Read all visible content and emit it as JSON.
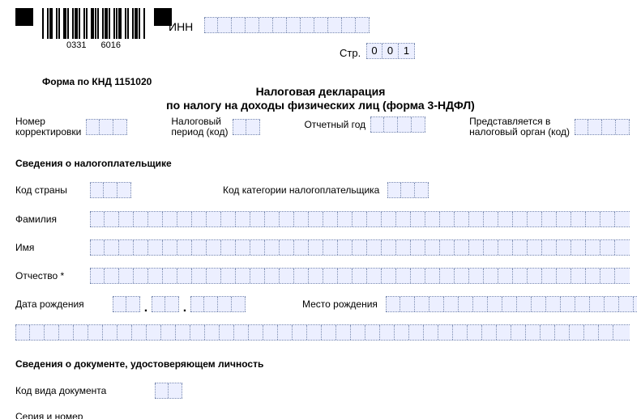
{
  "barcode": {
    "left": "0331",
    "right": "6016"
  },
  "header": {
    "inn_label": "ИНН",
    "page_label": "Стр.",
    "page_value": [
      "0",
      "0",
      "1"
    ],
    "form_knd": "Форма по КНД 1151020",
    "title_line1": "Налоговая декларация",
    "title_line2": "по налогу на доходы физических лиц (форма 3-НДФЛ)"
  },
  "hdr": {
    "correction_label_l1": "Номер",
    "correction_label_l2": "корректировки",
    "tax_period_label_l1": "Налоговый",
    "tax_period_label_l2": "период (код)",
    "report_year_label": "Отчетный год",
    "authority_label_l1": "Представляется в",
    "authority_label_l2": "налоговый орган (код)"
  },
  "section_taxpayer": "Сведения о налогоплательщике",
  "labels": {
    "country_code": "Код страны",
    "category_code": "Код категории налогоплательщика",
    "surname": "Фамилия",
    "name": "Имя",
    "patronymic": "Отчество *",
    "birth_date": "Дата рождения",
    "birth_place": "Место рождения"
  },
  "section_doc": "Сведения о документе, удостоверяющем личность",
  "doc": {
    "doc_code_label": "Код вида документа",
    "serial_label": "Серия и номер"
  }
}
